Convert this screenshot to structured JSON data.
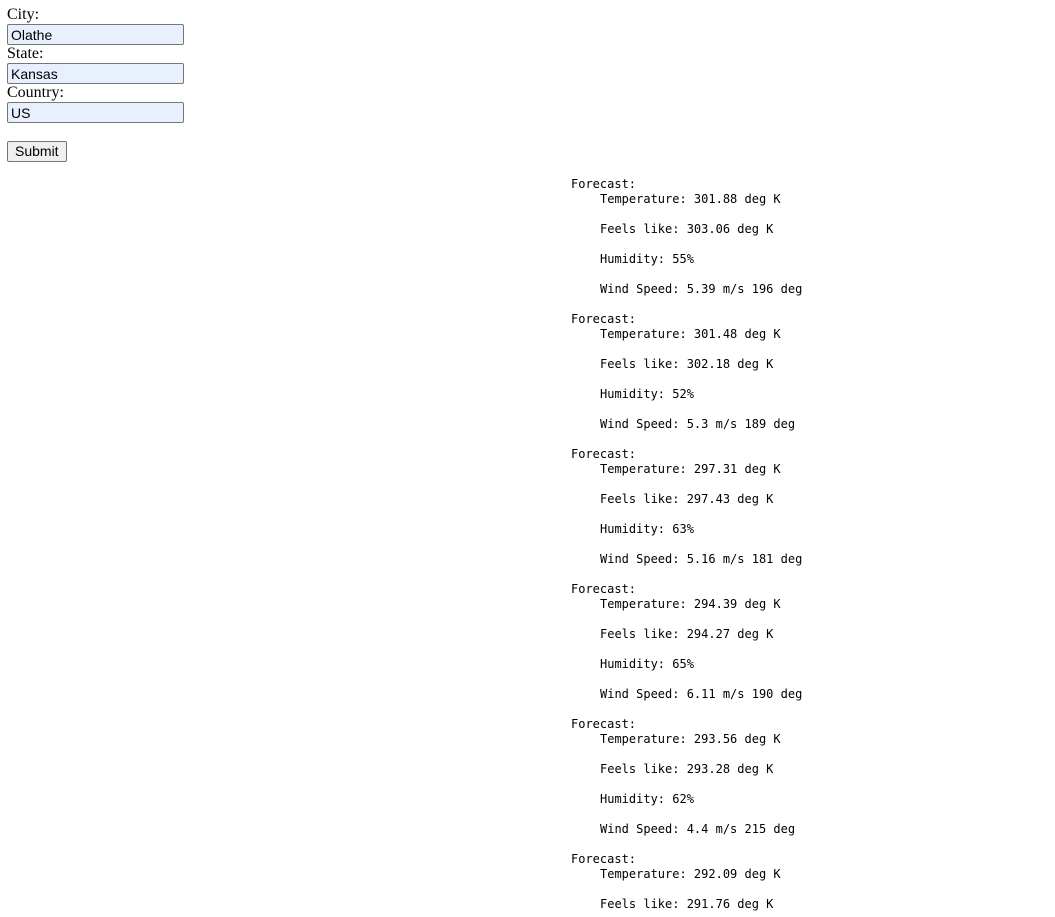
{
  "form": {
    "city_label": "City:",
    "city_value": "Olathe",
    "state_label": "State:",
    "state_value": "Kansas",
    "country_label": "Country:",
    "country_value": "US",
    "submit_label": "Submit"
  },
  "forecasts": [
    {
      "heading": "Forecast:",
      "temperature": "Temperature: 301.88 deg K",
      "feels_like": "Feels like: 303.06 deg K",
      "humidity": "Humidity: 55%",
      "wind": "Wind Speed: 5.39 m/s 196 deg"
    },
    {
      "heading": "Forecast:",
      "temperature": "Temperature: 301.48 deg K",
      "feels_like": "Feels like: 302.18 deg K",
      "humidity": "Humidity: 52%",
      "wind": "Wind Speed: 5.3 m/s 189 deg"
    },
    {
      "heading": "Forecast:",
      "temperature": "Temperature: 297.31 deg K",
      "feels_like": "Feels like: 297.43 deg K",
      "humidity": "Humidity: 63%",
      "wind": "Wind Speed: 5.16 m/s 181 deg"
    },
    {
      "heading": "Forecast:",
      "temperature": "Temperature: 294.39 deg K",
      "feels_like": "Feels like: 294.27 deg K",
      "humidity": "Humidity: 65%",
      "wind": "Wind Speed: 6.11 m/s 190 deg"
    },
    {
      "heading": "Forecast:",
      "temperature": "Temperature: 293.56 deg K",
      "feels_like": "Feels like: 293.28 deg K",
      "humidity": "Humidity: 62%",
      "wind": "Wind Speed: 4.4 m/s 215 deg"
    },
    {
      "heading": "Forecast:",
      "temperature": "Temperature: 292.09 deg K",
      "feels_like": "Feels like: 291.76 deg K"
    }
  ]
}
